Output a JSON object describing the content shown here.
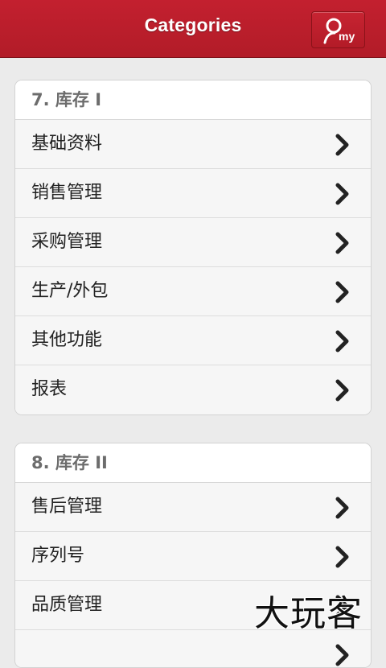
{
  "header": {
    "title": "Categories",
    "my_label": "my"
  },
  "groups": [
    {
      "title": "7. 库存 I",
      "items": [
        {
          "label": "基础资料"
        },
        {
          "label": "销售管理"
        },
        {
          "label": "采购管理"
        },
        {
          "label": "生产/外包"
        },
        {
          "label": "其他功能"
        },
        {
          "label": "报表"
        }
      ]
    },
    {
      "title": "8. 库存 II",
      "items": [
        {
          "label": "售后管理"
        },
        {
          "label": "序列号"
        },
        {
          "label": "品质管理"
        },
        {
          "label": ""
        }
      ]
    }
  ],
  "watermark": "大玩客",
  "colors": {
    "header_red": "#c3202f",
    "background": "#ebebeb",
    "group_text": "#6c6c6c"
  },
  "icons": {
    "user": "user-icon",
    "chevron": "chevron-right-icon"
  }
}
